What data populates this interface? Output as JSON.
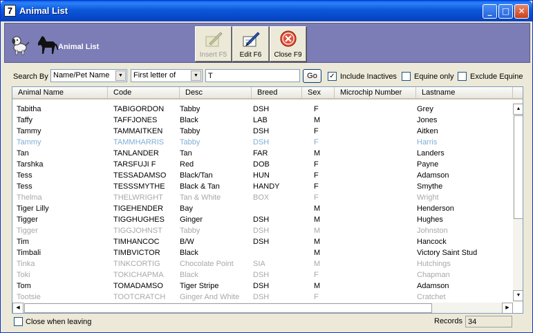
{
  "window": {
    "title": "Animal List",
    "app_icon_glyph": "7"
  },
  "header": {
    "title": "Animal List",
    "buttons": {
      "insert": {
        "label": "Insert F5",
        "enabled": false
      },
      "edit": {
        "label": "Edit F6",
        "enabled": true
      },
      "close": {
        "label": "Close F9",
        "enabled": true
      }
    }
  },
  "search": {
    "search_by_label": "Search By",
    "search_by_value": "Name/Pet Name",
    "match_mode_value": "First letter of",
    "query": "T",
    "go_label": "Go",
    "include_inactives": {
      "label": "Include Inactives",
      "checked": true
    },
    "equine_only": {
      "label": "Equine only",
      "checked": false
    },
    "exclude_equine": {
      "label": "Exclude Equine",
      "checked": false
    }
  },
  "table": {
    "columns": [
      "Animal Name",
      "Code",
      "Desc",
      "Breed",
      "Sex",
      "Microchip Number",
      "Lastname"
    ],
    "rows": [
      {
        "name": "Tabitha",
        "code": "TABIGORDON",
        "desc": "Tabby",
        "breed": "DSH",
        "sex": "F",
        "chip": "",
        "last": "Grey",
        "state": "normal"
      },
      {
        "name": "Taffy",
        "code": "TAFFJONES",
        "desc": "Black",
        "breed": "LAB",
        "sex": "M",
        "chip": "",
        "last": "Jones",
        "state": "normal"
      },
      {
        "name": "Tammy",
        "code": "TAMMAITKEN",
        "desc": "Tabby",
        "breed": "DSH",
        "sex": "F",
        "chip": "",
        "last": "Aitken",
        "state": "normal"
      },
      {
        "name": "Tammy",
        "code": "TAMMHARRIS",
        "desc": "Tabby",
        "breed": "DSH",
        "sex": "F",
        "chip": "",
        "last": "Harris",
        "state": "highlight"
      },
      {
        "name": "Tan",
        "code": "TANLANDER",
        "desc": "Tan",
        "breed": "FAR",
        "sex": "M",
        "chip": "",
        "last": "Landers",
        "state": "normal"
      },
      {
        "name": "Tarshka",
        "code": "TARSFUJI F",
        "desc": "Red",
        "breed": "DOB",
        "sex": "F",
        "chip": "",
        "last": "Payne",
        "state": "normal"
      },
      {
        "name": "Tess",
        "code": "TESSADAMSO",
        "desc": "Black/Tan",
        "breed": "HUN",
        "sex": "F",
        "chip": "",
        "last": "Adamson",
        "state": "normal"
      },
      {
        "name": "Tess",
        "code": "TESSSMYTHE",
        "desc": "Black & Tan",
        "breed": "HANDY",
        "sex": "F",
        "chip": "",
        "last": "Smythe",
        "state": "normal"
      },
      {
        "name": "Thelma",
        "code": "THELWRIGHT",
        "desc": "Tan & White",
        "breed": "BOX",
        "sex": "F",
        "chip": "",
        "last": "Wright",
        "state": "inactive"
      },
      {
        "name": "Tiger Lilly",
        "code": "TIGEHENDER",
        "desc": "Bay",
        "breed": "",
        "sex": "M",
        "chip": "",
        "last": "Henderson",
        "state": "normal"
      },
      {
        "name": "Tigger",
        "code": "TIGGHUGHES",
        "desc": "Ginger",
        "breed": "DSH",
        "sex": "M",
        "chip": "",
        "last": "Hughes",
        "state": "normal"
      },
      {
        "name": "Tigger",
        "code": "TIGGJOHNST",
        "desc": "Tabby",
        "breed": "DSH",
        "sex": "M",
        "chip": "",
        "last": "Johnston",
        "state": "inactive"
      },
      {
        "name": "Tim",
        "code": "TIMHANCOC",
        "desc": "B/W",
        "breed": "DSH",
        "sex": "M",
        "chip": "",
        "last": "Hancock",
        "state": "normal"
      },
      {
        "name": "Timbali",
        "code": "TIMBVICTOR",
        "desc": "Black",
        "breed": "",
        "sex": "M",
        "chip": "",
        "last": "Victory Saint Stud",
        "state": "normal"
      },
      {
        "name": "Tinka",
        "code": "TINKCORTIG",
        "desc": "Chocolate Point",
        "breed": "SIA",
        "sex": "M",
        "chip": "",
        "last": "Hutchings",
        "state": "inactive"
      },
      {
        "name": "Toki",
        "code": "TOKICHAPMA",
        "desc": "Black",
        "breed": "DSH",
        "sex": "F",
        "chip": "",
        "last": "Chapman",
        "state": "inactive"
      },
      {
        "name": "Tom",
        "code": "TOMADAMSO",
        "desc": "Tiger Stripe",
        "breed": "DSH",
        "sex": "M",
        "chip": "",
        "last": "Adamson",
        "state": "normal"
      },
      {
        "name": "Tootsie",
        "code": "TOOTCRATCH",
        "desc": "Ginger And White",
        "breed": "DSH",
        "sex": "F",
        "chip": "",
        "last": "Cratchet",
        "state": "inactive"
      }
    ]
  },
  "footer": {
    "close_when_leaving": {
      "label": "Close when leaving",
      "checked": false
    },
    "records_label": "Records",
    "records_count": "34"
  },
  "colors": {
    "title_bar": "#0A5FE6",
    "header_band": "#7C7CB6",
    "inactive_text": "#a8a8a8",
    "highlight_text": "#7EAED8"
  },
  "icons": [
    "app-icon",
    "minimize-icon",
    "maximize-icon",
    "close-window-icon",
    "dog-icon",
    "horse-icon",
    "insert-icon",
    "edit-icon",
    "close-icon",
    "dropdown-arrow-icon",
    "scroll-up-icon",
    "scroll-down-icon",
    "scroll-left-icon",
    "scroll-right-icon"
  ]
}
